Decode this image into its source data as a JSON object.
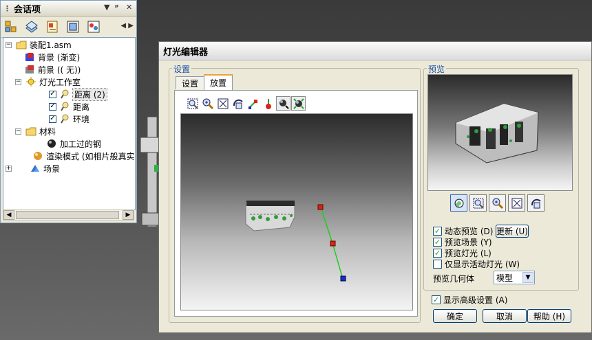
{
  "session": {
    "title": "会话项",
    "title_buttons": [
      "▼",
      "ᵖ",
      "✕"
    ],
    "toolbar_icons": [
      "assembly-tree-icon",
      "layers-icon",
      "properties-icon",
      "display-icon",
      "appearance-icon"
    ],
    "nav_prev": "◀",
    "nav_next": "▶",
    "tree": {
      "root": "装配1.asm",
      "background": "背景 (渐变)",
      "foreground": "前景 (( 无))",
      "light_studio": "灯光工作室",
      "light1": "距离 (2)",
      "light2": "距离",
      "light3": "环境",
      "materials": "材料",
      "material1": "加工过的钢",
      "render_mode": "渲染模式 (如相片般真实)",
      "scene": "场景"
    }
  },
  "dialog": {
    "title": "灯光编辑器",
    "settings_group": "设置",
    "tabs": [
      "设置",
      "放置"
    ],
    "preview_group": "预览",
    "dynamic_preview": "动态预览 (D)",
    "update_button": "更新 (U)",
    "preview_scene": "预览场景 (Y)",
    "preview_lights": "预览灯光 (L)",
    "show_active_only": "仅显示活动灯光 (W)",
    "preview_geometry_label": "预览几何体",
    "preview_geometry_value": "模型",
    "show_advanced": "显示高级设置 (A)",
    "ok": "确定",
    "cancel": "取消",
    "help": "帮助 (H)"
  }
}
